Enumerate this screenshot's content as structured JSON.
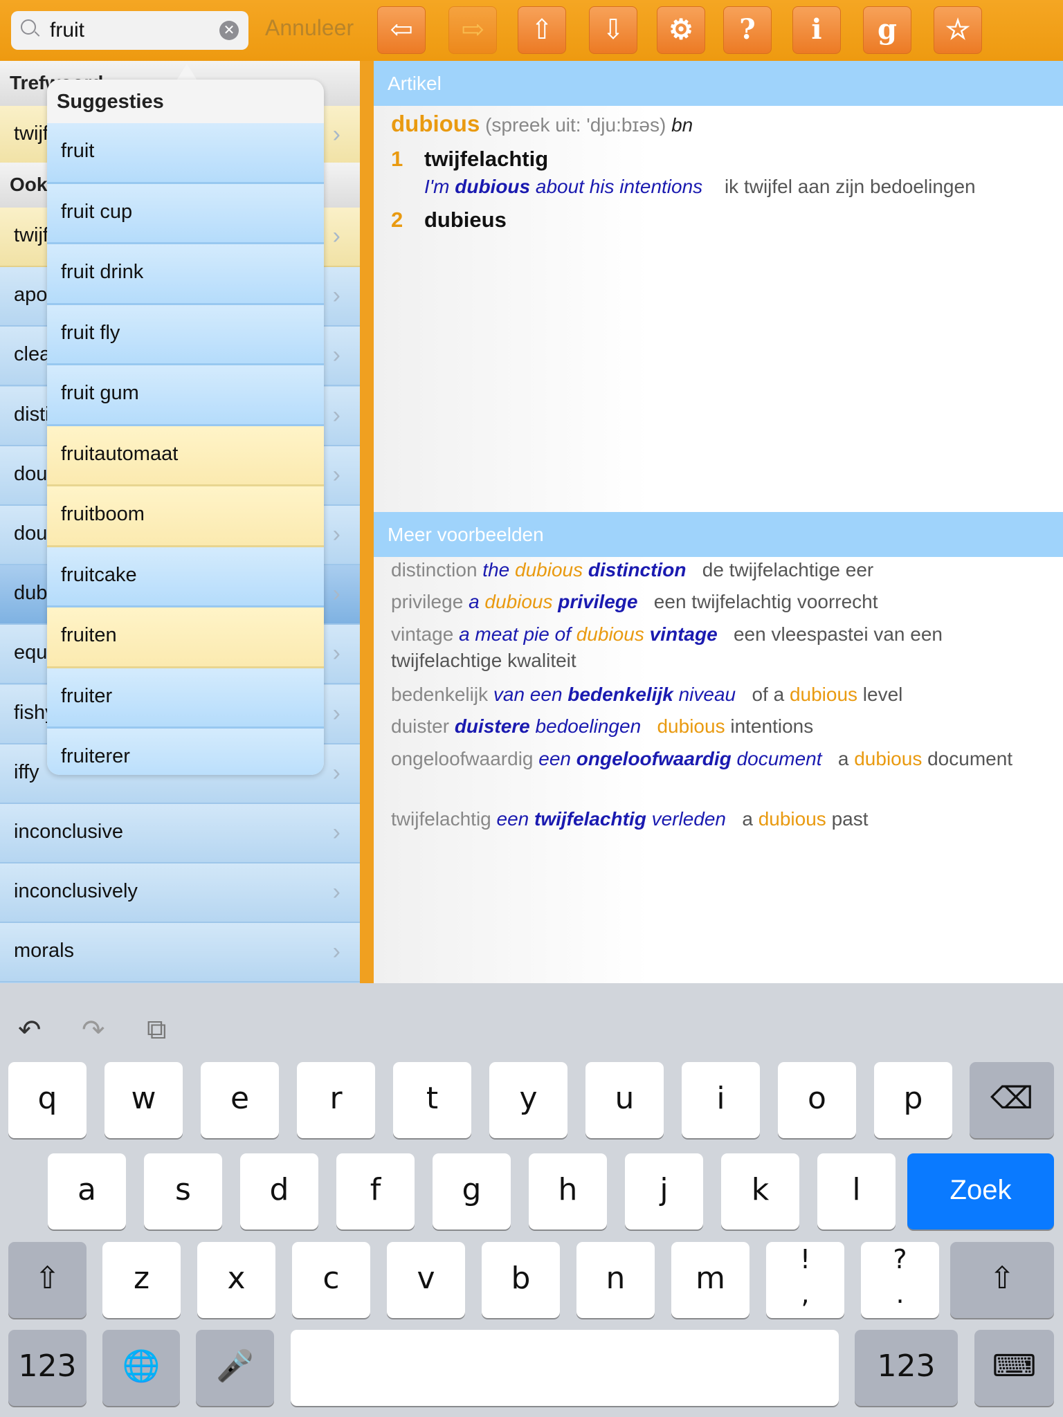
{
  "search": {
    "value": "fruit",
    "cancel": "Annuleer"
  },
  "toolbar": [
    {
      "name": "back",
      "glyph": "⇦",
      "enabled": true
    },
    {
      "name": "forward",
      "glyph": "⇨",
      "enabled": false
    },
    {
      "name": "up",
      "glyph": "⇧",
      "enabled": true
    },
    {
      "name": "down",
      "glyph": "⇩",
      "enabled": true
    },
    {
      "name": "settings",
      "glyph": "⚙",
      "enabled": true
    },
    {
      "name": "help",
      "glyph": "?",
      "enabled": true
    },
    {
      "name": "info",
      "glyph": "i",
      "enabled": true
    },
    {
      "name": "g",
      "glyph": "g",
      "enabled": true
    },
    {
      "name": "favorite",
      "glyph": "☆",
      "enabled": true
    }
  ],
  "left": {
    "header1": "Trefwoord",
    "row1": "twijfelachtig",
    "header2": "Ook",
    "rows": [
      {
        "label": "twijfelachtig",
        "style": "y"
      },
      {
        "label": "apocryphal",
        "style": ""
      },
      {
        "label": "clearly",
        "style": ""
      },
      {
        "label": "distinction",
        "style": ""
      },
      {
        "label": "doubtful",
        "style": ""
      },
      {
        "label": "doubtfully",
        "style": ""
      },
      {
        "label": "dubious",
        "style": "sel"
      },
      {
        "label": "equivocal",
        "style": ""
      },
      {
        "label": "fishy",
        "style": ""
      },
      {
        "label": "iffy",
        "style": ""
      },
      {
        "label": "inconclusive",
        "style": ""
      },
      {
        "label": "inconclusively",
        "style": ""
      },
      {
        "label": "morals",
        "style": ""
      }
    ]
  },
  "suggestions": {
    "title": "Suggesties",
    "items": [
      {
        "label": "fruit",
        "style": ""
      },
      {
        "label": "fruit cup",
        "style": ""
      },
      {
        "label": "fruit drink",
        "style": ""
      },
      {
        "label": "fruit fly",
        "style": ""
      },
      {
        "label": "fruit gum",
        "style": ""
      },
      {
        "label": "fruitautomaat",
        "style": "y"
      },
      {
        "label": "fruitboom",
        "style": "y"
      },
      {
        "label": "fruitcake",
        "style": ""
      },
      {
        "label": "fruiten",
        "style": "y"
      },
      {
        "label": "fruiter",
        "style": ""
      },
      {
        "label": "fruiterer",
        "style": ""
      }
    ]
  },
  "article": {
    "header": "Artikel",
    "headword": "dubious",
    "pron": "(spreek uit: 'dju:bɪəs)",
    "pos": "bn",
    "senses": [
      {
        "num": "1",
        "word": "twijfelachtig",
        "ex": {
          "a": "I'm ",
          "b": "dubious",
          "c": " about his intentions",
          "tr": "ik twijfel aan zijn bedoelingen"
        }
      },
      {
        "num": "2",
        "word": "dubieus"
      }
    ]
  },
  "more": {
    "header": "Meer voorbeelden",
    "items": [
      [
        [
          "gr",
          "distinction "
        ],
        [
          "bl",
          "the "
        ],
        [
          "oi",
          "dubious "
        ],
        [
          "bb",
          "distinction"
        ],
        [
          "dk",
          "   de twijfelachtige eer"
        ]
      ],
      [
        [
          "gr",
          "privilege "
        ],
        [
          "bl",
          "a "
        ],
        [
          "oi",
          "dubious "
        ],
        [
          "bb",
          "privilege"
        ],
        [
          "dk",
          "   een twijfelachtig voorrecht"
        ]
      ],
      [
        [
          "gr",
          "vintage "
        ],
        [
          "bl",
          "a meat pie of "
        ],
        [
          "oi",
          "dubious "
        ],
        [
          "bb",
          "vintage"
        ],
        [
          "dk",
          "   een vleespastei van een twijfelachtige kwaliteit"
        ]
      ],
      [
        [
          "gr",
          "bedenkelijk "
        ],
        [
          "bl",
          "van een "
        ],
        [
          "bb",
          "bedenkelijk"
        ],
        [
          "bl",
          " niveau"
        ],
        [
          "dk",
          "   of a "
        ],
        [
          "or",
          "dubious"
        ],
        [
          "dk",
          " level"
        ]
      ],
      [
        [
          "gr",
          "duister "
        ],
        [
          "bb",
          "duistere"
        ],
        [
          "bl",
          " bedoelingen"
        ],
        [
          "dk",
          "   "
        ],
        [
          "or",
          "dubious"
        ],
        [
          "dk",
          " intentions"
        ]
      ],
      [
        [
          "gr",
          "ongeloofwaardig "
        ],
        [
          "bl",
          "een "
        ],
        [
          "bb",
          "ongeloofwaardig"
        ],
        [
          "bl",
          " document"
        ],
        [
          "dk",
          "   a "
        ],
        [
          "or",
          "dubious"
        ],
        [
          "dk",
          " document"
        ]
      ],
      [
        [
          "gr",
          "twijfelachtig "
        ],
        [
          "bl",
          "een "
        ],
        [
          "bb",
          "twijfelachtig"
        ],
        [
          "bl",
          " verleden"
        ],
        [
          "dk",
          "   a "
        ],
        [
          "or",
          "dubious"
        ],
        [
          "dk",
          " past"
        ]
      ]
    ]
  },
  "keyboard": {
    "toolbar": [
      "↶",
      "↷",
      "⧉"
    ],
    "row1": [
      "q",
      "w",
      "e",
      "r",
      "t",
      "y",
      "u",
      "i",
      "o",
      "p"
    ],
    "backspace": "⌫",
    "row2": [
      "a",
      "s",
      "d",
      "f",
      "g",
      "h",
      "j",
      "k",
      "l"
    ],
    "go": "Zoek",
    "row3": [
      "z",
      "x",
      "c",
      "v",
      "b",
      "n",
      "m",
      "!\n,",
      "?\n."
    ],
    "shift": "⇧",
    "numbers": "123",
    "globe": "🌐",
    "mic": "🎤",
    "hide": "⌨"
  }
}
